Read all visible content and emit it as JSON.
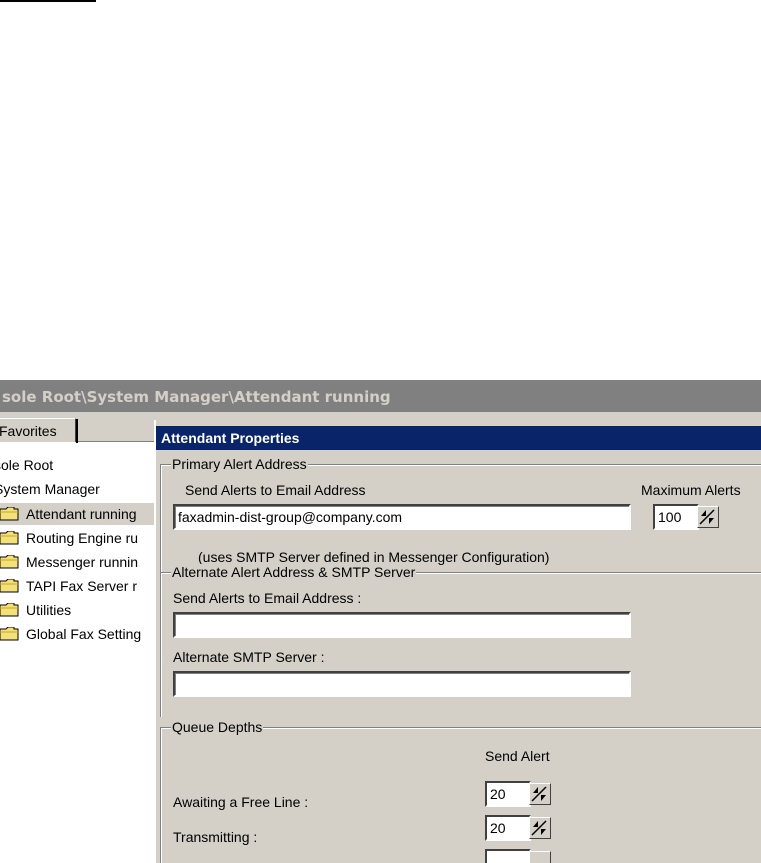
{
  "window": {
    "title": "sole Root\\System Manager\\Attendant running"
  },
  "tab": {
    "label": "Favorites"
  },
  "tree": {
    "items": [
      {
        "label": "sole Root",
        "indent": 0,
        "folder": false
      },
      {
        "label": "System Manager",
        "indent": 0,
        "folder": false
      },
      {
        "label": "Attendant running",
        "indent": 1,
        "folder": true,
        "selected": true
      },
      {
        "label": "Routing Engine ru",
        "indent": 1,
        "folder": true
      },
      {
        "label": "Messenger runnin",
        "indent": 1,
        "folder": true
      },
      {
        "label": "TAPI Fax Server r",
        "indent": 1,
        "folder": true
      },
      {
        "label": "Utilities",
        "indent": 1,
        "folder": true
      },
      {
        "label": "Global Fax Setting",
        "indent": 1,
        "folder": true
      }
    ]
  },
  "dialog": {
    "title": "Attendant Properties",
    "primary": {
      "group_title": "Primary Alert Address",
      "email_label": "Send Alerts to Email Address",
      "email_value": "faxadmin-dist-group@company.com",
      "max_label": "Maximum Alerts",
      "max_value": "100",
      "note": "(uses SMTP Server defined in Messenger Configuration)"
    },
    "alternate": {
      "group_title": "Alternate Alert Address & SMTP Server",
      "email_label": "Send Alerts to Email Address :",
      "email_value": "",
      "smtp_label": "Alternate SMTP Server :",
      "smtp_value": ""
    },
    "queue": {
      "group_title": "Queue Depths",
      "column_header": "Send Alert",
      "rows": [
        {
          "label": "Awaiting a Free Line :",
          "value": "20"
        },
        {
          "label": "Transmitting :",
          "value": "20"
        }
      ]
    }
  },
  "colors": {
    "titlebar_gray": "#808080",
    "dialog_title_blue": "#0a246a",
    "face": "#d4d0c8"
  }
}
